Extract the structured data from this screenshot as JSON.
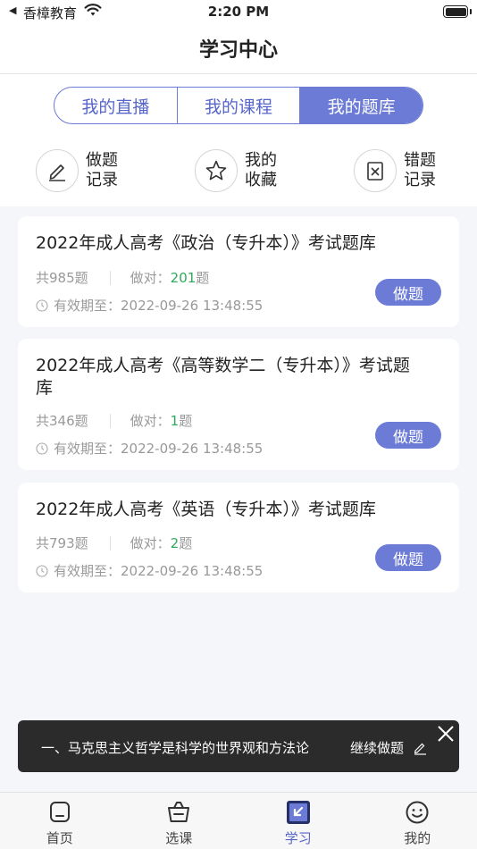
{
  "status_bar": {
    "back_label": "◀",
    "carrier": "香樟教育",
    "time": "2:20 PM"
  },
  "header": {
    "title": "学习中心"
  },
  "segments": [
    {
      "label": "我的直播",
      "active": false
    },
    {
      "label": "我的课程",
      "active": false
    },
    {
      "label": "我的题库",
      "active": true
    }
  ],
  "shortcuts": [
    {
      "icon": "pencil-icon",
      "line1": "做题",
      "line2": "记录"
    },
    {
      "icon": "star-icon",
      "line1": "我的",
      "line2": "收藏"
    },
    {
      "icon": "wrong-answer-icon",
      "line1": "错题",
      "line2": "记录"
    }
  ],
  "cards": [
    {
      "title": "2022年成人高考《政治（专升本）》考试题库",
      "total": "共985题",
      "correct_label": "做对：",
      "correct": "201",
      "correct_unit": "题",
      "expiry": "有效期至：2022-09-26 13:48:55",
      "button": "做题"
    },
    {
      "title": "2022年成人高考《高等数学二（专升本）》考试题库",
      "total": "共346题",
      "correct_label": "做对：",
      "correct": "1",
      "correct_unit": "题",
      "expiry": "有效期至：2022-09-26 13:48:55",
      "button": "做题"
    },
    {
      "title": "2022年成人高考《英语（专升本）》考试题库",
      "total": "共793题",
      "correct_label": "做对：",
      "correct": "2",
      "correct_unit": "题",
      "expiry": "有效期至：2022-09-26 13:48:55",
      "button": "做题"
    }
  ],
  "toast": {
    "text": "一、马克思主义哲学是科学的世界观和方法论",
    "continue_label": "继续做题"
  },
  "tabs": [
    {
      "icon": "home-icon",
      "label": "首页",
      "active": false
    },
    {
      "icon": "basket-icon",
      "label": "选课",
      "active": false
    },
    {
      "icon": "study-icon",
      "label": "学习",
      "active": true
    },
    {
      "icon": "smiley-icon",
      "label": "我的",
      "active": false
    }
  ],
  "colors": {
    "accent": "#6c7bd6",
    "correct": "#2faa5a",
    "toast_bg": "#2b2b2b"
  }
}
